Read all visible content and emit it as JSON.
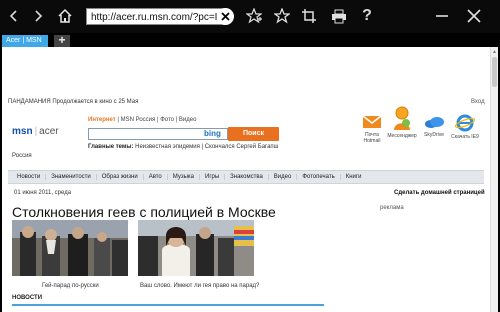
{
  "toolbar": {
    "url": "http://acer.ru.msn.com/?pc=I",
    "buttons": [
      "back-icon",
      "forward-icon",
      "home-icon",
      "add-favorite-icon",
      "favorites-icon",
      "crop-icon",
      "print-icon",
      "help-icon",
      "minimize-icon",
      "close-icon"
    ]
  },
  "tabs": {
    "active_label": "Acer | MSN",
    "new_tab_label": "+"
  },
  "page": {
    "promo_text": "ПАНДАМАНИЯ Продолжается в кино с 25 Мая",
    "login_text": "Вход",
    "logo": {
      "msn": "msn",
      "partner": "acer"
    },
    "region": "Россия",
    "search": {
      "tabs": [
        "Интернет",
        "MSN Россия",
        "Фото",
        "Видео"
      ],
      "engine": "bing",
      "button": "Поиск",
      "topics_label": "Главные темы:",
      "topics": "Неизвестная эпидемия | Скончался Сергей Багапш"
    },
    "apps": [
      {
        "icon": "mail-icon",
        "label": "Почта Hotmail"
      },
      {
        "icon": "messenger-icon",
        "label": "Мессенджер"
      },
      {
        "icon": "skydrive-icon",
        "label": "SkyDrive"
      },
      {
        "icon": "ie-icon",
        "label": "Скачать IE9"
      }
    ],
    "nav": [
      "Новости",
      "Знаменитости",
      "Образ жизни",
      "Авто",
      "Музыка",
      "Игры",
      "Знакомства",
      "Видео",
      "Фотопечать",
      "Книги"
    ],
    "date": "01 июня 2011, среда",
    "homepage_link": "Сделать домашней страницей",
    "ad_label": "реклама",
    "headline": "Столкновения геев с полицией в Москве",
    "captions": [
      "Гей-парад по-русски",
      "Ваш слово. Имеют ли гея право на парад?"
    ],
    "news_header": "НОВОСТИ"
  }
}
